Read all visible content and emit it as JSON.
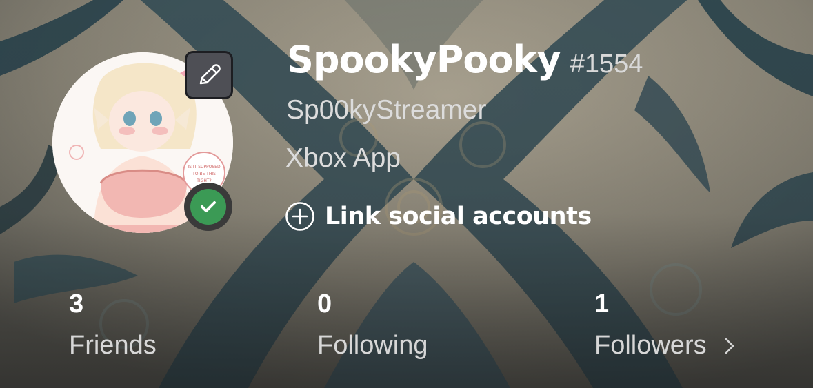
{
  "profile": {
    "gamertag": "SpookyPooky",
    "suffix": "#1554",
    "real_name": "Sp00kyStreamer",
    "platform": "Xbox App",
    "avatar_text": "IS IT SUPPOSED TO BE THIS TIGHT?",
    "presence": "online"
  },
  "actions": {
    "link_social": "Link social accounts"
  },
  "stats": {
    "friends": {
      "count": "3",
      "label": "Friends"
    },
    "following": {
      "count": "0",
      "label": "Following"
    },
    "followers": {
      "count": "1",
      "label": "Followers"
    }
  },
  "icons": {
    "edit": "pencil-icon",
    "status": "checkmark-icon",
    "link": "plus-circle-icon",
    "followers_nav": "chevron-right-icon"
  },
  "colors": {
    "presence_online": "#3b9a55",
    "edit_button_bg": "#4e4f55",
    "text_primary": "#ffffff",
    "text_secondary": "#dcdcdc"
  }
}
